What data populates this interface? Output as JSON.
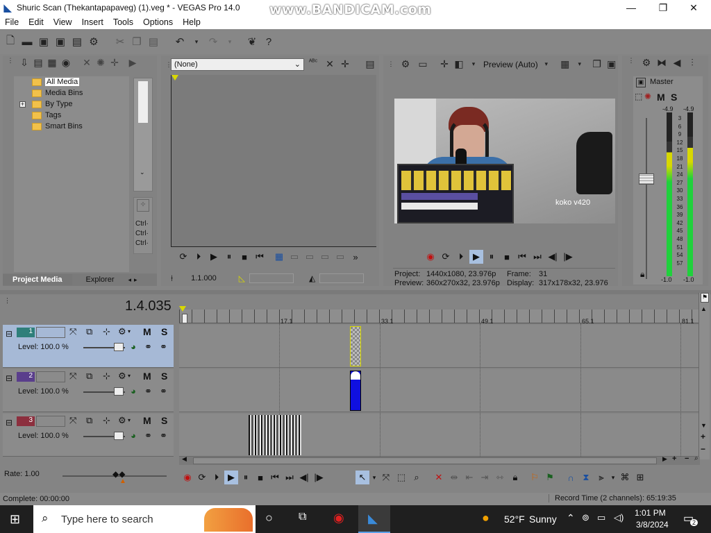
{
  "window": {
    "title": "Shuric Scan (Thekantapapaveg) (1).veg * - VEGAS Pro 14.0",
    "watermark": "www.BANDICAM.com"
  },
  "menu": [
    "File",
    "Edit",
    "View",
    "Insert",
    "Tools",
    "Options",
    "Help"
  ],
  "project_media": {
    "tree": [
      "All Media",
      "Media Bins",
      "By Type",
      "Tags",
      "Smart Bins"
    ],
    "tabs": [
      "Project Media",
      "Explorer"
    ],
    "side_text": [
      "Ctrl·",
      "Ctrl·",
      "Ctrl·"
    ]
  },
  "trimmer": {
    "dropdown_value": "(None)",
    "timecode": "1.1.000"
  },
  "preview": {
    "mode": "Preview (Auto)",
    "project_label": "Project:",
    "project_value": "1440x1080, 23.976p",
    "frame_label": "Frame:",
    "frame_value": "31",
    "preview_label": "Preview:",
    "preview_value": "360x270x32, 23.976p",
    "display_label": "Display:",
    "display_value": "317x178x32, 23.976",
    "overlay_text": "koko v420"
  },
  "master": {
    "title": "Master",
    "m": "M",
    "s": "S",
    "peak_left": "-4.9",
    "peak_right": "-4.9",
    "scale": [
      "3",
      "6",
      "9",
      "12",
      "15",
      "18",
      "21",
      "24",
      "27",
      "30",
      "33",
      "36",
      "39",
      "42",
      "45",
      "48",
      "51",
      "54",
      "57"
    ],
    "bottom_left": "-1.0",
    "bottom_right": "-1.0",
    "level_left": 0.82,
    "level_right": 0.85
  },
  "timeline": {
    "position": "1.4.035",
    "ruler": [
      "17.1",
      "33.1",
      "49.1",
      "65.1",
      "81.1"
    ],
    "tracks": [
      {
        "num": "1",
        "level": "Level: 100.0 %",
        "m": "M",
        "s": "S",
        "color": "#2f7f7a"
      },
      {
        "num": "2",
        "level": "Level: 100.0 %",
        "m": "M",
        "s": "S",
        "color": "#5a3e8c"
      },
      {
        "num": "3",
        "level": "Level: 100.0 %",
        "m": "M",
        "s": "S",
        "color": "#8c2f3e"
      }
    ],
    "rate": "Rate: 1.00"
  },
  "status": {
    "left": "Complete: 00:00:00",
    "right": "Record Time (2 channels): 65:19:35"
  },
  "taskbar": {
    "search_placeholder": "Type here to search",
    "weather_temp": "52°F",
    "weather_desc": "Sunny",
    "time": "1:01 PM",
    "date": "3/8/2024",
    "notif_count": "2"
  }
}
